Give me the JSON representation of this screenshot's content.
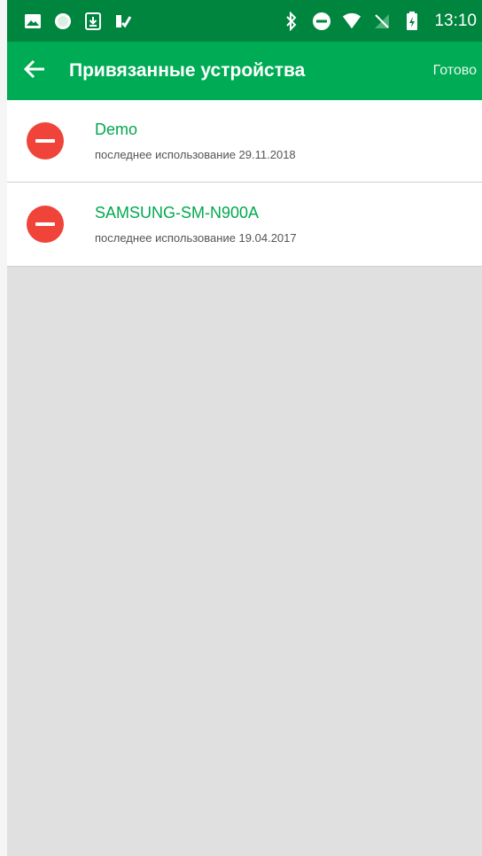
{
  "status_bar": {
    "time": "13:10",
    "icons_left": [
      "image-icon",
      "circle-app-icon",
      "download-icon",
      "checkmark-icon"
    ],
    "icons_right": [
      "bluetooth-icon",
      "do-not-disturb-icon",
      "wifi-icon",
      "no-sim-icon",
      "battery-icon"
    ],
    "background_color": "#00853e"
  },
  "app_bar": {
    "title": "Привязанные устройства",
    "done_label": "Готово",
    "back_icon": "arrow-left-icon",
    "background_color": "#00ab55"
  },
  "devices": [
    {
      "name": "Demo",
      "last_used": "последнее использование 29.11.2018"
    },
    {
      "name": "SAMSUNG-SM-N900A",
      "last_used": "последнее использование 19.04.2017"
    }
  ],
  "colors": {
    "accent_green": "#00a84f",
    "remove_red": "#f0443a",
    "background_grey": "#e0e0e0"
  }
}
